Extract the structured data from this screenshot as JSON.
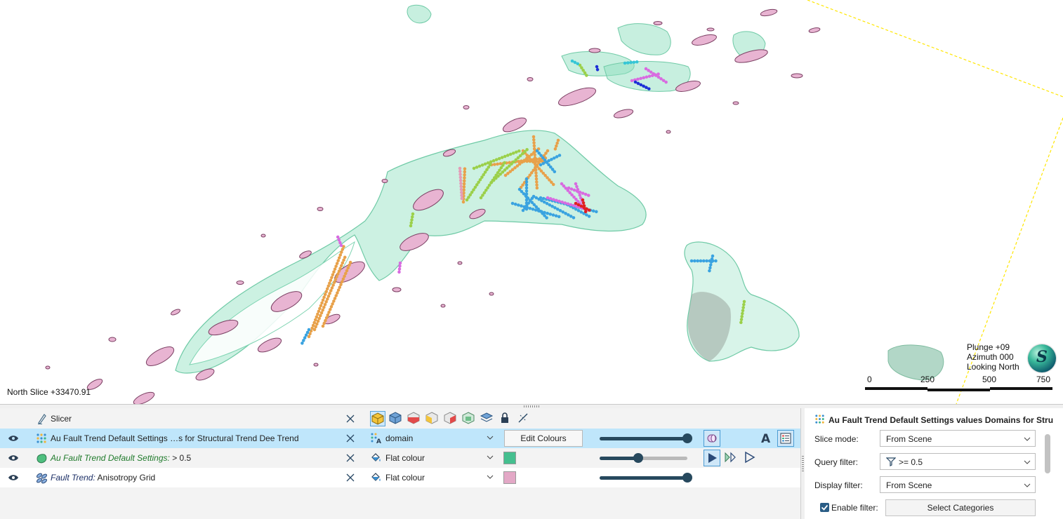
{
  "scene": {
    "slice_label": "North Slice +33470.91",
    "orientation": {
      "plunge": "Plunge +09",
      "azimuth": "Azimuth 000",
      "looking": "Looking North"
    },
    "compass_letter": "S",
    "scale_ticks": [
      "0",
      "250",
      "500",
      "750"
    ],
    "colors": {
      "shell": "#8fe0bf",
      "ellipsoid": "#e8b4d2",
      "drill_orange": "#e8a14a",
      "drill_blue": "#3aa3e0",
      "drill_magenta": "#d86be0",
      "drill_green": "#9bd04a",
      "drill_red": "#e02020",
      "boundary": "#ffe600"
    }
  },
  "objects": [
    {
      "label": "Slicer",
      "icon": "slicer-icon"
    },
    {
      "label_main": "Au Fault Trend Default Settings …s for Structural Trend Dee Trend",
      "icon": "block-model-icon",
      "colour_mode": "domain",
      "edit_colours": "Edit Colours",
      "selected": true,
      "opacity": 100
    },
    {
      "label_italic": "Au Fault Trend Default Settings:",
      "label_rest": " > 0.5",
      "icon": "isosurface-icon",
      "colour_mode": "Flat colour",
      "swatch": "#45bf8f",
      "opacity": 44
    },
    {
      "label_italic": "Fault Trend:",
      "label_rest": " Anisotropy Grid",
      "icon": "anisotropy-icon",
      "colour_mode": "Flat colour",
      "swatch": "#e3a8c6",
      "opacity": 100
    }
  ],
  "properties": {
    "title": "Au Fault Trend Default Settings values Domains for Struct…",
    "slice_mode_label": "Slice mode:",
    "slice_mode_value": "From Scene",
    "query_filter_label": "Query filter:",
    "query_filter_value": ">= 0.5",
    "display_filter_label": "Display filter:",
    "display_filter_value": "From Scene",
    "enable_filter_label": "Enable filter:",
    "enable_filter_checked": true,
    "select_categories": "Select Categories"
  }
}
